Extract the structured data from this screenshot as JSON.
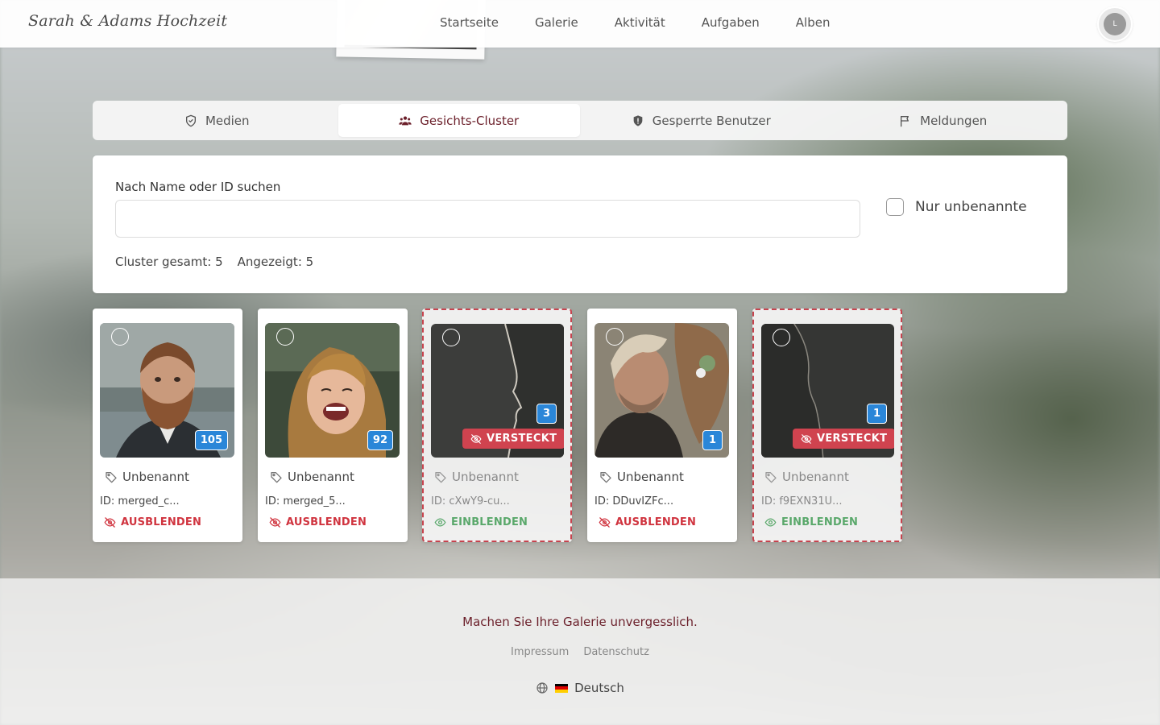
{
  "brand": "Sarah & Adams Hochzeit",
  "nav": [
    "Startseite",
    "Galerie",
    "Aktivität",
    "Aufgaben",
    "Alben"
  ],
  "avatar_initial": "L",
  "tabs": [
    {
      "label": "Medien",
      "icon": "shield-check-icon",
      "active": false
    },
    {
      "label": "Gesichts-Cluster",
      "icon": "users-icon",
      "active": true
    },
    {
      "label": "Gesperrte Benutzer",
      "icon": "shield-icon",
      "active": false
    },
    {
      "label": "Meldungen",
      "icon": "flag-icon",
      "active": false
    }
  ],
  "search": {
    "label": "Nach Name oder ID suchen",
    "value": "",
    "placeholder": ""
  },
  "filter": {
    "label": "Nur unbenannte",
    "checked": false
  },
  "stats": {
    "total": "Cluster gesamt: 5",
    "shown": "Angezeigt: 5"
  },
  "clusters": [
    {
      "name": "Unbenannt",
      "id": "ID: merged_c...",
      "count": "105",
      "hidden": false,
      "action": "AUSBLENDEN"
    },
    {
      "name": "Unbenannt",
      "id": "ID: merged_5...",
      "count": "92",
      "hidden": false,
      "action": "AUSBLENDEN"
    },
    {
      "name": "Unbenannt",
      "id": "ID: cXwY9-cu...",
      "count": "3",
      "hidden": true,
      "hidden_label": "VERSTECKT",
      "action": "EINBLENDEN"
    },
    {
      "name": "Unbenannt",
      "id": "ID: DDuvIZFc...",
      "count": "1",
      "hidden": false,
      "action": "AUSBLENDEN"
    },
    {
      "name": "Unbenannt",
      "id": "ID: f9EXN31U...",
      "count": "1",
      "hidden": true,
      "hidden_label": "VERSTECKT",
      "action": "EINBLENDEN"
    }
  ],
  "footer": {
    "tagline": "Machen Sie Ihre Galerie unvergesslich.",
    "links": [
      "Impressum",
      "Datenschutz"
    ],
    "language": "Deutsch"
  },
  "colors": {
    "accent": "#6b1f2a",
    "badge_blue": "#2a86d8",
    "danger": "#d0343f",
    "success": "#5aa86b"
  }
}
